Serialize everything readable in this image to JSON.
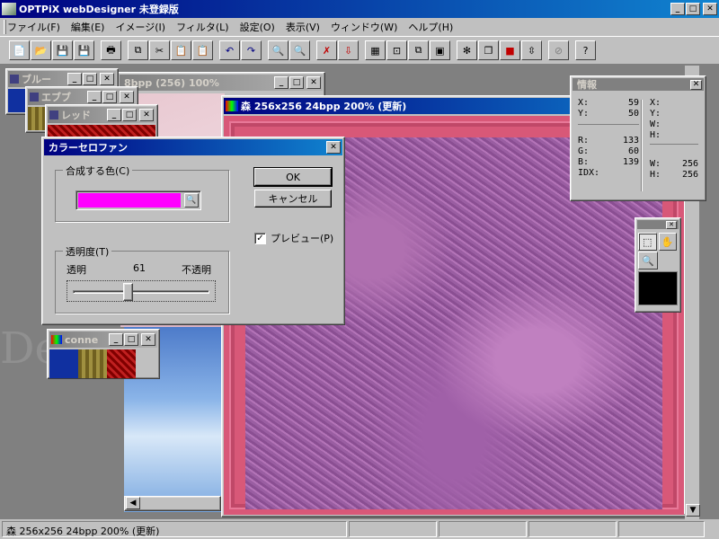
{
  "app": {
    "title": "OPTPiX webDesigner 未登録版",
    "window_controls": {
      "minimize": "_",
      "maximize": "□",
      "close": "✕"
    }
  },
  "menu": [
    "ファイル(F)",
    "編集(E)",
    "イメージ(I)",
    "フィルタ(L)",
    "設定(O)",
    "表示(V)",
    "ウィンドウ(W)",
    "ヘルプ(H)"
  ],
  "toolbar_icons": [
    "new-icon",
    "open-icon",
    "save-icon",
    "save-as-icon",
    "print-icon",
    "copy-icon",
    "cut-icon",
    "paste-icon",
    "paste-new-icon",
    "undo-icon",
    "redo-icon",
    "zoom-in-icon",
    "zoom-out-icon",
    "crop-icon",
    "export-icon",
    "grid-icon",
    "resize-icon",
    "layers-icon",
    "frame-icon",
    "effect-icon",
    "duplicate-icon",
    "palette-icon",
    "split-icon",
    "stop-icon",
    "help-icon"
  ],
  "background_windows": {
    "blue": {
      "title": "ブルー"
    },
    "ebf": {
      "title": "エブブ"
    },
    "red": {
      "title": "レッド"
    },
    "bgbpp": {
      "title": "8bpp (256) 100%"
    },
    "conne": {
      "title": "conne"
    }
  },
  "main_image": {
    "title": "森  256x256  24bpp  200% (更新)"
  },
  "dialog": {
    "title": "カラーセロファン",
    "color_group_label": "合成する色(C)",
    "selected_color": "#ff00ff",
    "ok_label": "OK",
    "cancel_label": "キャンセル",
    "preview_label": "プレビュー(P)",
    "preview_checked": true,
    "opacity_group_label": "透明度(T)",
    "transparent_label": "透明",
    "opaque_label": "不透明",
    "opacity_value": "61",
    "opacity_fraction": 0.4
  },
  "info_panel": {
    "title": "情報",
    "x_label": "X:",
    "x_value": "59",
    "y_label": "Y:",
    "y_value": "50",
    "r_label": "R:",
    "r_value": "133",
    "g_label": "G:",
    "g_value": "60",
    "b_label": "B:",
    "b_value": "139",
    "idx_label": "IDX:",
    "x2_label": "X:",
    "y2_label": "Y:",
    "w_label": "W:",
    "h_label": "H:",
    "w2_label": "W:",
    "w2_value": "256",
    "h2_label": "H:",
    "h2_value": "256"
  },
  "status_bar": {
    "text": "森  256x256  24bpp  200% (更新)"
  }
}
